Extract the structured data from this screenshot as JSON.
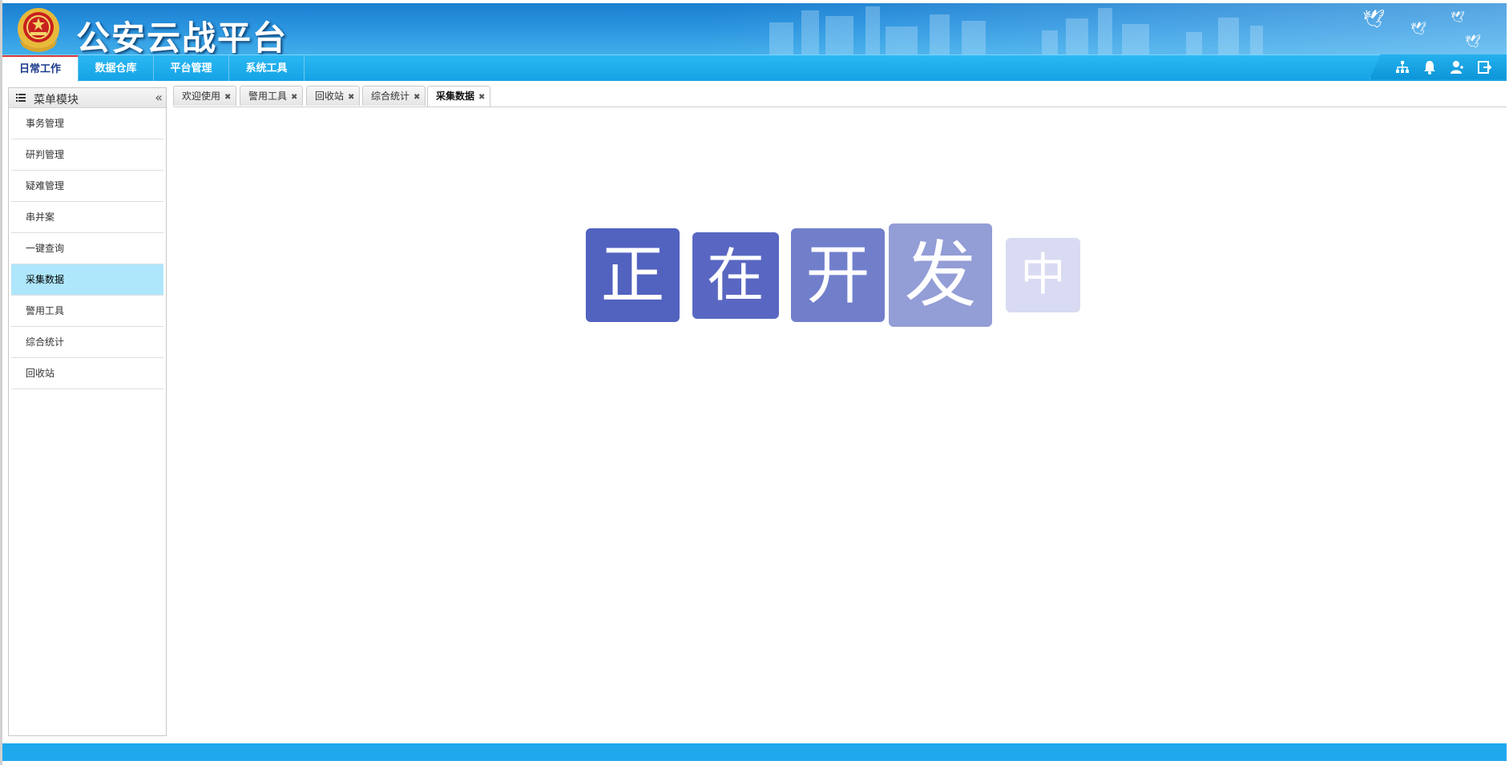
{
  "app": {
    "title": "公安云战平台",
    "emblem": "police-emblem-icon"
  },
  "nav": {
    "tabs": [
      {
        "label": "日常工作",
        "active": true
      },
      {
        "label": "数据仓库",
        "active": false
      },
      {
        "label": "平台管理",
        "active": false
      },
      {
        "label": "系统工具",
        "active": false
      }
    ],
    "icons": [
      "sitemap-icon",
      "bell-icon",
      "user-icon",
      "logout-icon"
    ]
  },
  "sidebar": {
    "title": "菜单模块",
    "collapse_glyph": "«",
    "items": [
      {
        "label": "事务管理",
        "active": false
      },
      {
        "label": "研判管理",
        "active": false
      },
      {
        "label": "疑难管理",
        "active": false
      },
      {
        "label": "串并案",
        "active": false
      },
      {
        "label": "一键查询",
        "active": false
      },
      {
        "label": "采集数据",
        "active": true
      },
      {
        "label": "警用工具",
        "active": false
      },
      {
        "label": "综合统计",
        "active": false
      },
      {
        "label": "回收站",
        "active": false
      }
    ]
  },
  "content_tabs": [
    {
      "label": "欢迎使用",
      "active": false
    },
    {
      "label": "警用工具",
      "active": false
    },
    {
      "label": "回收站",
      "active": false
    },
    {
      "label": "综合统计",
      "active": false
    },
    {
      "label": "采集数据",
      "active": true
    }
  ],
  "developing": {
    "chars": [
      "正",
      "在",
      "开",
      "发",
      "中"
    ],
    "colors": [
      "#5262bf",
      "#5a67c2",
      "#717fcb",
      "#939dd6",
      "#d8dbf1"
    ]
  },
  "colors": {
    "header": "#2a93df",
    "navbar": "#15a3e6",
    "active_menu": "#aee6fb",
    "footer": "#1fa8ec"
  }
}
